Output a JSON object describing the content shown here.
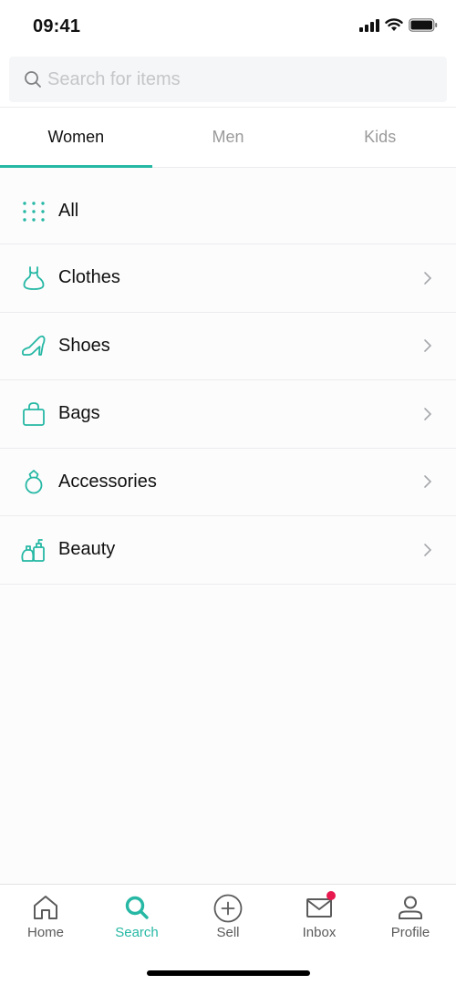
{
  "status_bar": {
    "time": "09:41"
  },
  "search": {
    "placeholder": "Search for items",
    "value": ""
  },
  "tabs": [
    {
      "label": "Women",
      "active": true
    },
    {
      "label": "Men",
      "active": false
    },
    {
      "label": "Kids",
      "active": false
    }
  ],
  "categories": [
    {
      "label": "All",
      "icon": "grid-dots-icon",
      "has_chevron": false
    },
    {
      "label": "Clothes",
      "icon": "dress-icon",
      "has_chevron": true
    },
    {
      "label": "Shoes",
      "icon": "high-heel-icon",
      "has_chevron": true
    },
    {
      "label": "Bags",
      "icon": "bag-icon",
      "has_chevron": true
    },
    {
      "label": "Accessories",
      "icon": "ring-icon",
      "has_chevron": true
    },
    {
      "label": "Beauty",
      "icon": "perfume-icon",
      "has_chevron": true
    }
  ],
  "bottom_nav": [
    {
      "label": "Home",
      "icon": "home-icon",
      "active": false
    },
    {
      "label": "Search",
      "icon": "search-icon",
      "active": true
    },
    {
      "label": "Sell",
      "icon": "plus-circle-icon",
      "active": false
    },
    {
      "label": "Inbox",
      "icon": "mail-icon",
      "active": false,
      "badge": true
    },
    {
      "label": "Profile",
      "icon": "user-icon",
      "active": false
    }
  ],
  "colors": {
    "accent": "#26b8a4",
    "badge": "#e8194f",
    "text": "#111111",
    "muted": "#9a9a9a"
  }
}
